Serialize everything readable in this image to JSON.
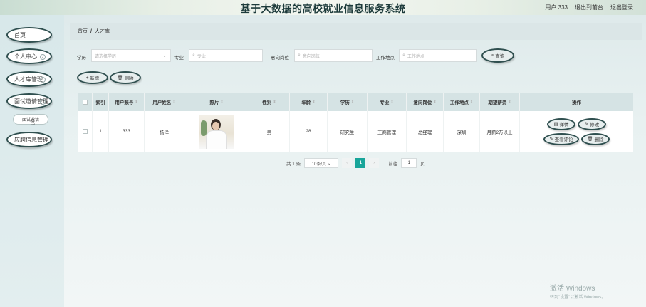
{
  "header": {
    "title": "基于大数据的高校就业信息服务系统",
    "user_label": "用户 333",
    "front_link": "退出到前台",
    "logout_link": "退出登录"
  },
  "sidebar": {
    "items": [
      {
        "label": "首页"
      },
      {
        "label": "个人中心",
        "chevron": "⌄"
      },
      {
        "label": "人才库管理",
        "chevron": "⌄"
      },
      {
        "label": "面试邀请管理",
        "chevron": "⌃"
      },
      {
        "label": "应聘信息管理",
        "chevron": "⌄"
      }
    ],
    "sub_item": "面试邀请"
  },
  "breadcrumb": {
    "home": "首页",
    "sep": "/",
    "current": "人才库"
  },
  "filters": {
    "education_label": "学历",
    "education_placeholder": "请选择学历",
    "major_label": "专业",
    "major_placeholder": "专业",
    "position_label": "意向岗位",
    "position_placeholder": "意向岗位",
    "location_label": "工作地点",
    "location_placeholder": "工作地点",
    "search_button": "查询"
  },
  "actions": {
    "add_button": "新增",
    "delete_button": "删除"
  },
  "table": {
    "headers": [
      "索引",
      "用户账号",
      "用户姓名",
      "照片",
      "性别",
      "年龄",
      "学历",
      "专业",
      "意向岗位",
      "工作地点",
      "期望薪资",
      "操作"
    ],
    "rows": [
      {
        "index": "1",
        "account": "333",
        "name": "杨洋",
        "gender": "男",
        "age": "28",
        "education": "研究生",
        "major": "工商管理",
        "position": "总经理",
        "location": "深圳",
        "salary": "月薪2万以上"
      }
    ],
    "row_actions": {
      "detail": "详情",
      "edit": "修改",
      "comments": "查看评论",
      "delete": "删除"
    }
  },
  "pagination": {
    "total": "共 1 条",
    "page_size": "10条/页",
    "current_page": "1",
    "goto_label": "前往",
    "goto_value": "1",
    "page_unit": "页"
  },
  "watermark": {
    "line1": "激活 Windows",
    "line2": "转到\"设置\"以激活 Windows。"
  },
  "colors": {
    "accent": "#18a59a",
    "header_row": "#d5e3e4",
    "border_dark": "#2f4f4f"
  }
}
